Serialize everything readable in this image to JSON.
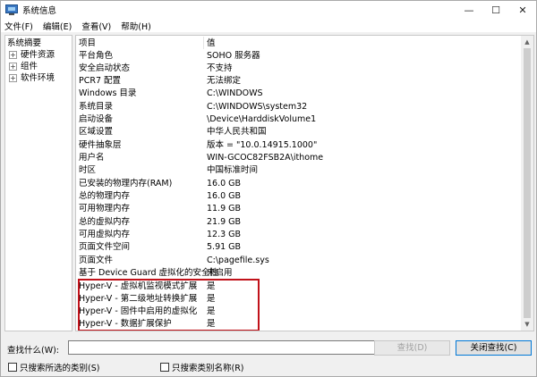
{
  "window": {
    "title": "系统信息",
    "controls": [
      "—",
      "☐",
      "✕"
    ]
  },
  "menu": [
    "文件(F)",
    "编辑(E)",
    "查看(V)",
    "帮助(H)"
  ],
  "tree": {
    "root": "系统摘要",
    "nodes": [
      {
        "expander": "+",
        "label": "硬件资源"
      },
      {
        "expander": "+",
        "label": "组件"
      },
      {
        "expander": "+",
        "label": "软件环境"
      }
    ]
  },
  "table": {
    "header": {
      "item": "项目",
      "value": "值"
    },
    "rows": [
      {
        "item": "平台角色",
        "value": "SOHO 服务器"
      },
      {
        "item": "安全启动状态",
        "value": "不支持"
      },
      {
        "item": "PCR7 配置",
        "value": "无法绑定"
      },
      {
        "item": "Windows 目录",
        "value": "C:\\WINDOWS"
      },
      {
        "item": "系统目录",
        "value": "C:\\WINDOWS\\system32"
      },
      {
        "item": "启动设备",
        "value": "\\Device\\HarddiskVolume1"
      },
      {
        "item": "区域设置",
        "value": "中华人民共和国"
      },
      {
        "item": "硬件抽象层",
        "value": "版本 = \"10.0.14915.1000\""
      },
      {
        "item": "用户名",
        "value": "WIN-GCOC82FSB2A\\ithome"
      },
      {
        "item": "时区",
        "value": "中国标准时间"
      },
      {
        "item": "已安装的物理内存(RAM)",
        "value": "16.0 GB"
      },
      {
        "item": "总的物理内存",
        "value": "16.0 GB"
      },
      {
        "item": "可用物理内存",
        "value": "11.9 GB"
      },
      {
        "item": "总的虚拟内存",
        "value": "21.9 GB"
      },
      {
        "item": "可用虚拟内存",
        "value": "12.3 GB"
      },
      {
        "item": "页面文件空间",
        "value": "5.91 GB"
      },
      {
        "item": "页面文件",
        "value": "C:\\pagefile.sys"
      },
      {
        "item": "基于 Device Guard 虚拟化的安全性",
        "value": "未启用"
      },
      {
        "item": "Hyper-V - 虚拟机监视模式扩展",
        "value": "是"
      },
      {
        "item": "Hyper-V - 第二级地址转换扩展",
        "value": "是"
      },
      {
        "item": "Hyper-V - 固件中启用的虚拟化",
        "value": "是"
      },
      {
        "item": "Hyper-V - 数据扩展保护",
        "value": "是"
      }
    ]
  },
  "find": {
    "label": "查找什么(W):",
    "value": "",
    "find_button": "查找(D)",
    "close_button": "关闭查找(C)",
    "check_selected": "只搜索所选的类别(S)",
    "check_names": "只搜索类别名称(R)"
  },
  "colors": {
    "highlight_border": "#c1121a",
    "primary_button_border": "#0078d7"
  }
}
